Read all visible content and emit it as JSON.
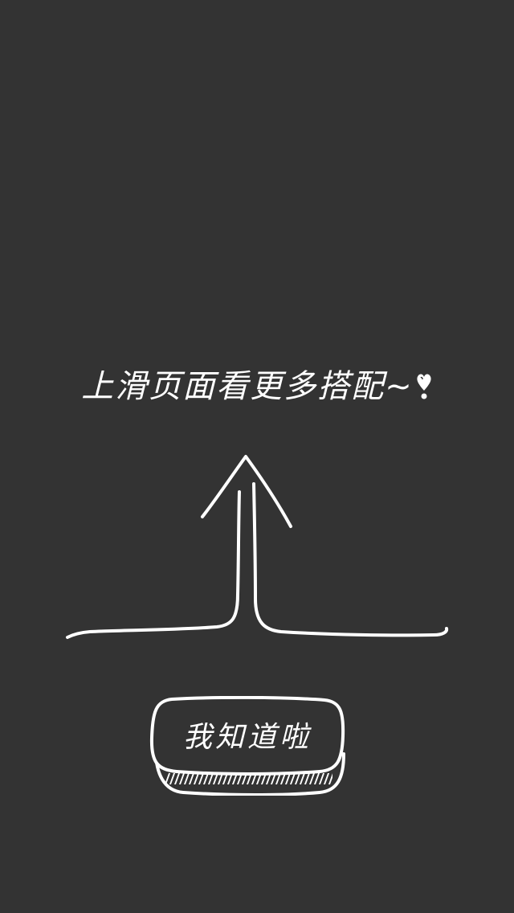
{
  "guide": {
    "text": "上滑页面看更多搭配~",
    "heart_icon": "heart-exclamation-icon",
    "arrow_icon": "swipe-up-arrow-icon"
  },
  "confirm_button": {
    "label": "我知道啦"
  },
  "colors": {
    "background": "#333333",
    "foreground": "#ffffff"
  }
}
